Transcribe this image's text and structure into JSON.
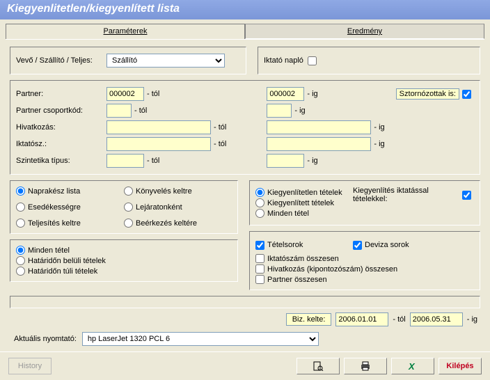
{
  "title": "Kiegyenlitetlen/kiegyenlített lista",
  "tabs": {
    "params": "Paraméterek",
    "result": "Eredmény"
  },
  "top": {
    "vevo_label": "Vevő / Szállító / Teljes:",
    "vevo_value": "Szállító",
    "iktato_naplo": "Iktató napló"
  },
  "filters": {
    "partner": "Partner:",
    "partner_from": "000002",
    "partner_to": "000002",
    "tol": "- tól",
    "ig": "- ig",
    "sztorno": "Sztornózottak is:",
    "partner_csoport": "Partner csoportkód:",
    "hivatkozas": "Hivatkozás:",
    "iktatosz": "Iktatósz.:",
    "szintetika": "Szintetika típus:"
  },
  "left_opts1": {
    "naprakesz": "Naprakész lista",
    "konyveles": "Könyvelés keltre",
    "esedekessegre": "Esedékességre",
    "lejaratonkent": "Lejáratonként",
    "teljesites": "Teljesítés keltre",
    "beerkezes": "Beérkezés keltére"
  },
  "left_opts2": {
    "minden": "Minden tétel",
    "beluli": "Határidőn belüli tételek",
    "tuli": "Határidőn túli tételek"
  },
  "right_opts": {
    "kiegyenlitetlen": "Kiegyenlítetlen tételek",
    "kiegyenlitett": "Kiegyenlített tételek",
    "minden_tetel": "Minden tétel",
    "iktatassal": "Kiegyenlítés iktatással tételekkel:",
    "tetelsorok": "Tételsorok",
    "deviza": "Deviza sorok",
    "iktatoszam_osszesen": "Iktatószám összesen",
    "hivatkozas_osszesen": "Hivatkozás (kipontozószám) összesen",
    "partner_osszesen": "Partner összesen"
  },
  "biz": {
    "label": "Biz. kelte:",
    "from": "2006.01.01",
    "to": "2006.05.31",
    "tol": "- tól",
    "ig": "- ig"
  },
  "printer": {
    "label": "Aktuális nyomtató:",
    "value": "hp LaserJet 1320 PCL 6"
  },
  "buttons": {
    "history": "History",
    "kilepes": "Kilépés"
  }
}
